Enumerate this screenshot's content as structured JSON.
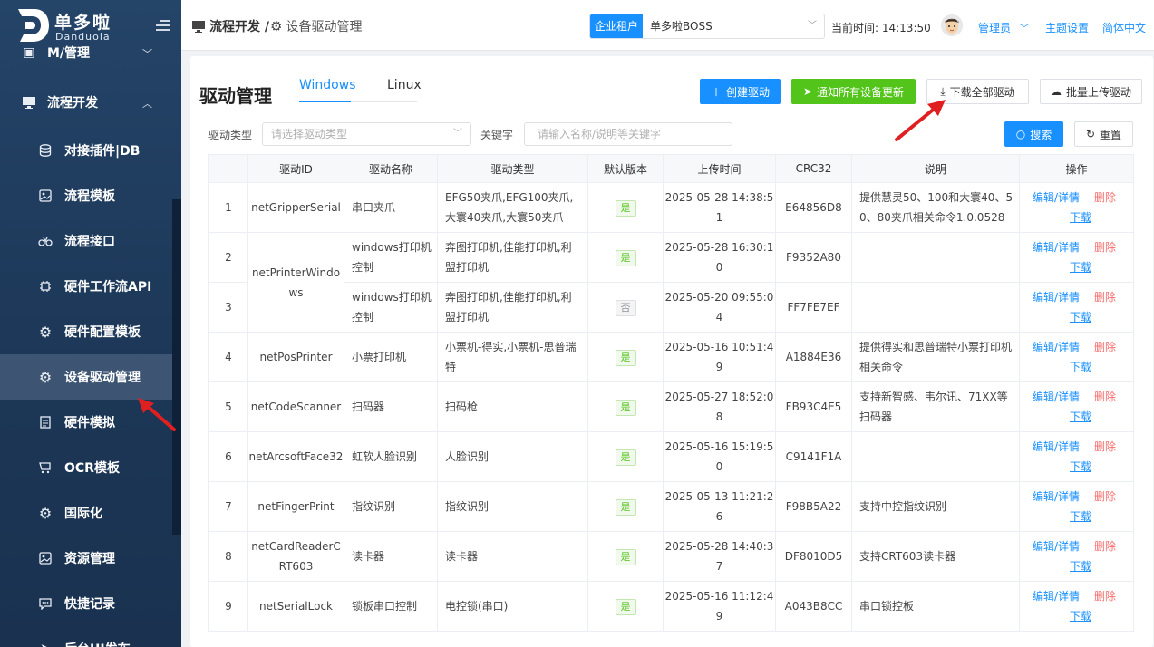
{
  "brand": {
    "title": "单多啦",
    "subtitle": "Danduola"
  },
  "sidebar": {
    "items": [
      {
        "label": "M/管理",
        "icon": "folder-icon"
      },
      {
        "label": "流程开发",
        "icon": "monitor-icon"
      },
      {
        "label": "对接插件|DB",
        "icon": "database-icon"
      },
      {
        "label": "流程模板",
        "icon": "template-icon"
      },
      {
        "label": "流程接口",
        "icon": "link-icon"
      },
      {
        "label": "硬件工作流API",
        "icon": "chip-icon"
      },
      {
        "label": "硬件配置模板",
        "icon": "gear-icon"
      },
      {
        "label": "设备驱动管理",
        "icon": "gear-icon"
      },
      {
        "label": "硬件模拟",
        "icon": "document-icon"
      },
      {
        "label": "OCR模板",
        "icon": "cart-icon"
      },
      {
        "label": "国际化",
        "icon": "gear-icon"
      },
      {
        "label": "资源管理",
        "icon": "image-icon"
      },
      {
        "label": "快捷记录",
        "icon": "chat-icon"
      },
      {
        "label": "后台UI发布",
        "icon": "send-icon"
      }
    ]
  },
  "header": {
    "breadcrumb_parent": "流程开发 /",
    "breadcrumb_current": "设备驱动管理",
    "tenant_tag": "企业租户",
    "tenant_value": "单多啦BOSS",
    "time": "当前时间: 14:13:50",
    "user": "管理员",
    "theme": "主题设置",
    "language": "简体中文"
  },
  "page": {
    "title": "驱动管理",
    "tabs": [
      "Windows",
      "Linux"
    ],
    "active_tab": "Windows",
    "buttons": {
      "create": "创建驱动",
      "notify": "通知所有设备更新",
      "download_all": "下载全部驱动",
      "batch_upload": "批量上传驱动",
      "search": "搜索",
      "reset": "重置"
    },
    "filters": {
      "type_label": "驱动类型",
      "type_placeholder": "请选择驱动类型",
      "keyword_label": "关键字",
      "keyword_placeholder": "请输入名称/说明等关键字"
    }
  },
  "table": {
    "headers": [
      "",
      "驱动ID",
      "驱动名称",
      "驱动类型",
      "默认版本",
      "上传时间",
      "CRC32",
      "说明",
      "操作"
    ],
    "ops": {
      "edit": "编辑/详情",
      "delete": "删除",
      "download": "下载"
    },
    "default_yes": "是",
    "default_no": "否",
    "rows": [
      {
        "no": "1",
        "id": "netGripperSerial",
        "name": "串口夹爪",
        "type": "EFG50夹爪,EFG100夹爪,大寰40夹爪,大寰50夹爪",
        "default": "是",
        "time": "2025-05-28 14:38:51",
        "crc": "E64856D8",
        "desc": "提供慧灵50、100和大寰40、50、80夹爪相关命令1.0.0528"
      },
      {
        "no": "2",
        "id": "netPrinterWindows",
        "name": "windows打印机控制",
        "type": "奔图打印机,佳能打印机,利盟打印机",
        "default": "是",
        "time": "2025-05-28 16:30:10",
        "crc": "F9352A80",
        "desc": ""
      },
      {
        "no": "3",
        "id": "",
        "name": "windows打印机控制",
        "type": "奔图打印机,佳能打印机,利盟打印机",
        "default": "否",
        "time": "2025-05-20 09:55:04",
        "crc": "FF7FE7EF",
        "desc": ""
      },
      {
        "no": "4",
        "id": "netPosPrinter",
        "name": "小票打印机",
        "type": "小票机-得实,小票机-思普瑞特",
        "default": "是",
        "time": "2025-05-16 10:51:49",
        "crc": "A1884E36",
        "desc": "提供得实和思普瑞特小票打印机相关命令"
      },
      {
        "no": "5",
        "id": "netCodeScanner",
        "name": "扫码器",
        "type": "扫码枪",
        "default": "是",
        "time": "2025-05-27 18:52:08",
        "crc": "FB93C4E5",
        "desc": "支持新智感、韦尔讯、71XX等扫码器"
      },
      {
        "no": "6",
        "id": "netArcsoftFace32",
        "name": "虹软人脸识别",
        "type": "人脸识别",
        "default": "是",
        "time": "2025-05-16 15:19:50",
        "crc": "C9141F1A",
        "desc": ""
      },
      {
        "no": "7",
        "id": "netFingerPrint",
        "name": "指纹识别",
        "type": "指纹识别",
        "default": "是",
        "time": "2025-05-13 11:21:26",
        "crc": "F98B5A22",
        "desc": "支持中控指纹识别"
      },
      {
        "no": "8",
        "id": "netCardReaderCRT603",
        "name": "读卡器",
        "type": "读卡器",
        "default": "是",
        "time": "2025-05-28 14:40:37",
        "crc": "DF8010D5",
        "desc": "支持CRT603读卡器"
      },
      {
        "no": "9",
        "id": "netSerialLock",
        "name": "锁板串口控制",
        "type": "电控锁(串口)",
        "default": "是",
        "time": "2025-05-16 11:12:49",
        "crc": "A043B8CC",
        "desc": "串口锁控板"
      }
    ]
  },
  "colors": {
    "primary": "#1890ff",
    "success": "#52c41a",
    "danger": "#f56c6c",
    "sidebar": "#1c3656",
    "annotation_arrow": "#e02020"
  }
}
